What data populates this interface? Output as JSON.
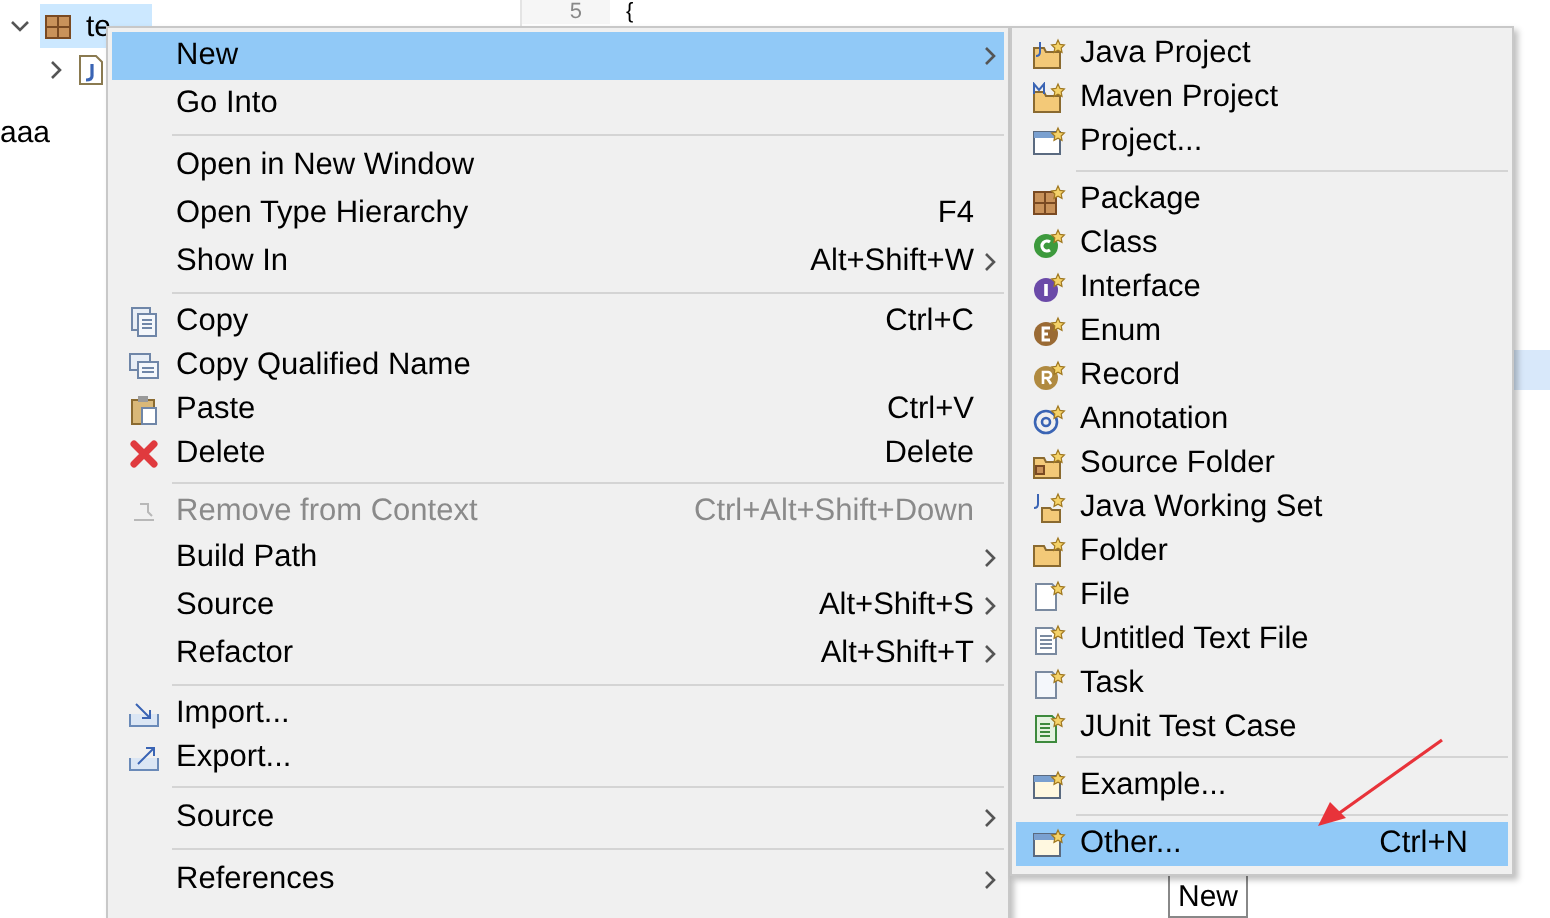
{
  "tree": {
    "items": [
      {
        "label": "te",
        "expanded": true,
        "selected": true,
        "children": [
          {
            "expanded": false
          }
        ]
      }
    ]
  },
  "outline_text": "aaa",
  "editor": {
    "line_number": "5",
    "code": "{"
  },
  "bottom_panel": {
    "button": "New"
  },
  "context_menu": {
    "items": [
      {
        "kind": "item",
        "label": "New",
        "submenu": true,
        "selected": true
      },
      {
        "kind": "item",
        "label": "Go Into",
        "selected": false
      },
      {
        "kind": "separator"
      },
      {
        "kind": "item",
        "label": "Open in New Window",
        "selected": false
      },
      {
        "kind": "item",
        "label": "Open Type Hierarchy",
        "shortcut": "F4",
        "selected": false
      },
      {
        "kind": "item",
        "label": "Show In",
        "shortcut": "Alt+Shift+W",
        "submenu": true,
        "selected": false
      },
      {
        "kind": "separator"
      },
      {
        "kind": "item",
        "label": "Copy",
        "shortcut": "Ctrl+C",
        "selected": false
      },
      {
        "kind": "item",
        "label": "Copy Qualified Name",
        "selected": false
      },
      {
        "kind": "item",
        "label": "Paste",
        "shortcut": "Ctrl+V",
        "selected": false
      },
      {
        "kind": "item",
        "label": "Delete",
        "shortcut": "Delete",
        "selected": false
      },
      {
        "kind": "separator"
      },
      {
        "kind": "item",
        "label": "Remove from Context",
        "shortcut": "Ctrl+Alt+Shift+Down",
        "disabled": true,
        "selected": false
      },
      {
        "kind": "item",
        "label": "Build Path",
        "submenu": true,
        "selected": false
      },
      {
        "kind": "item",
        "label": "Source",
        "shortcut": "Alt+Shift+S",
        "submenu": true,
        "selected": false
      },
      {
        "kind": "item",
        "label": "Refactor",
        "shortcut": "Alt+Shift+T",
        "submenu": true,
        "selected": false
      },
      {
        "kind": "separator"
      },
      {
        "kind": "item",
        "label": "Import...",
        "selected": false
      },
      {
        "kind": "item",
        "label": "Export...",
        "selected": false
      },
      {
        "kind": "separator"
      },
      {
        "kind": "item",
        "label": "Source",
        "submenu": true,
        "selected": false
      },
      {
        "kind": "separator"
      },
      {
        "kind": "item",
        "label": "References",
        "submenu": true,
        "selected": false
      }
    ]
  },
  "submenu": {
    "items": [
      {
        "kind": "item",
        "label": "Java Project",
        "selected": false
      },
      {
        "kind": "item",
        "label": "Maven Project",
        "selected": false
      },
      {
        "kind": "item",
        "label": "Project...",
        "selected": false
      },
      {
        "kind": "separator"
      },
      {
        "kind": "item",
        "label": "Package",
        "selected": false
      },
      {
        "kind": "item",
        "label": "Class",
        "selected": false
      },
      {
        "kind": "item",
        "label": "Interface",
        "selected": false
      },
      {
        "kind": "item",
        "label": "Enum",
        "selected": false
      },
      {
        "kind": "item",
        "label": "Record",
        "selected": false
      },
      {
        "kind": "item",
        "label": "Annotation",
        "selected": false
      },
      {
        "kind": "item",
        "label": "Source Folder",
        "selected": false
      },
      {
        "kind": "item",
        "label": "Java Working Set",
        "selected": false
      },
      {
        "kind": "item",
        "label": "Folder",
        "selected": false
      },
      {
        "kind": "item",
        "label": "File",
        "selected": false
      },
      {
        "kind": "item",
        "label": "Untitled Text File",
        "selected": false
      },
      {
        "kind": "item",
        "label": "Task",
        "selected": false
      },
      {
        "kind": "item",
        "label": "JUnit Test Case",
        "selected": false
      },
      {
        "kind": "separator"
      },
      {
        "kind": "item",
        "label": "Example...",
        "selected": false
      },
      {
        "kind": "separator"
      },
      {
        "kind": "item",
        "label": "Other...",
        "shortcut": "Ctrl+N",
        "selected": true
      }
    ]
  },
  "annotations": [
    {
      "kind": "arrow"
    }
  ]
}
